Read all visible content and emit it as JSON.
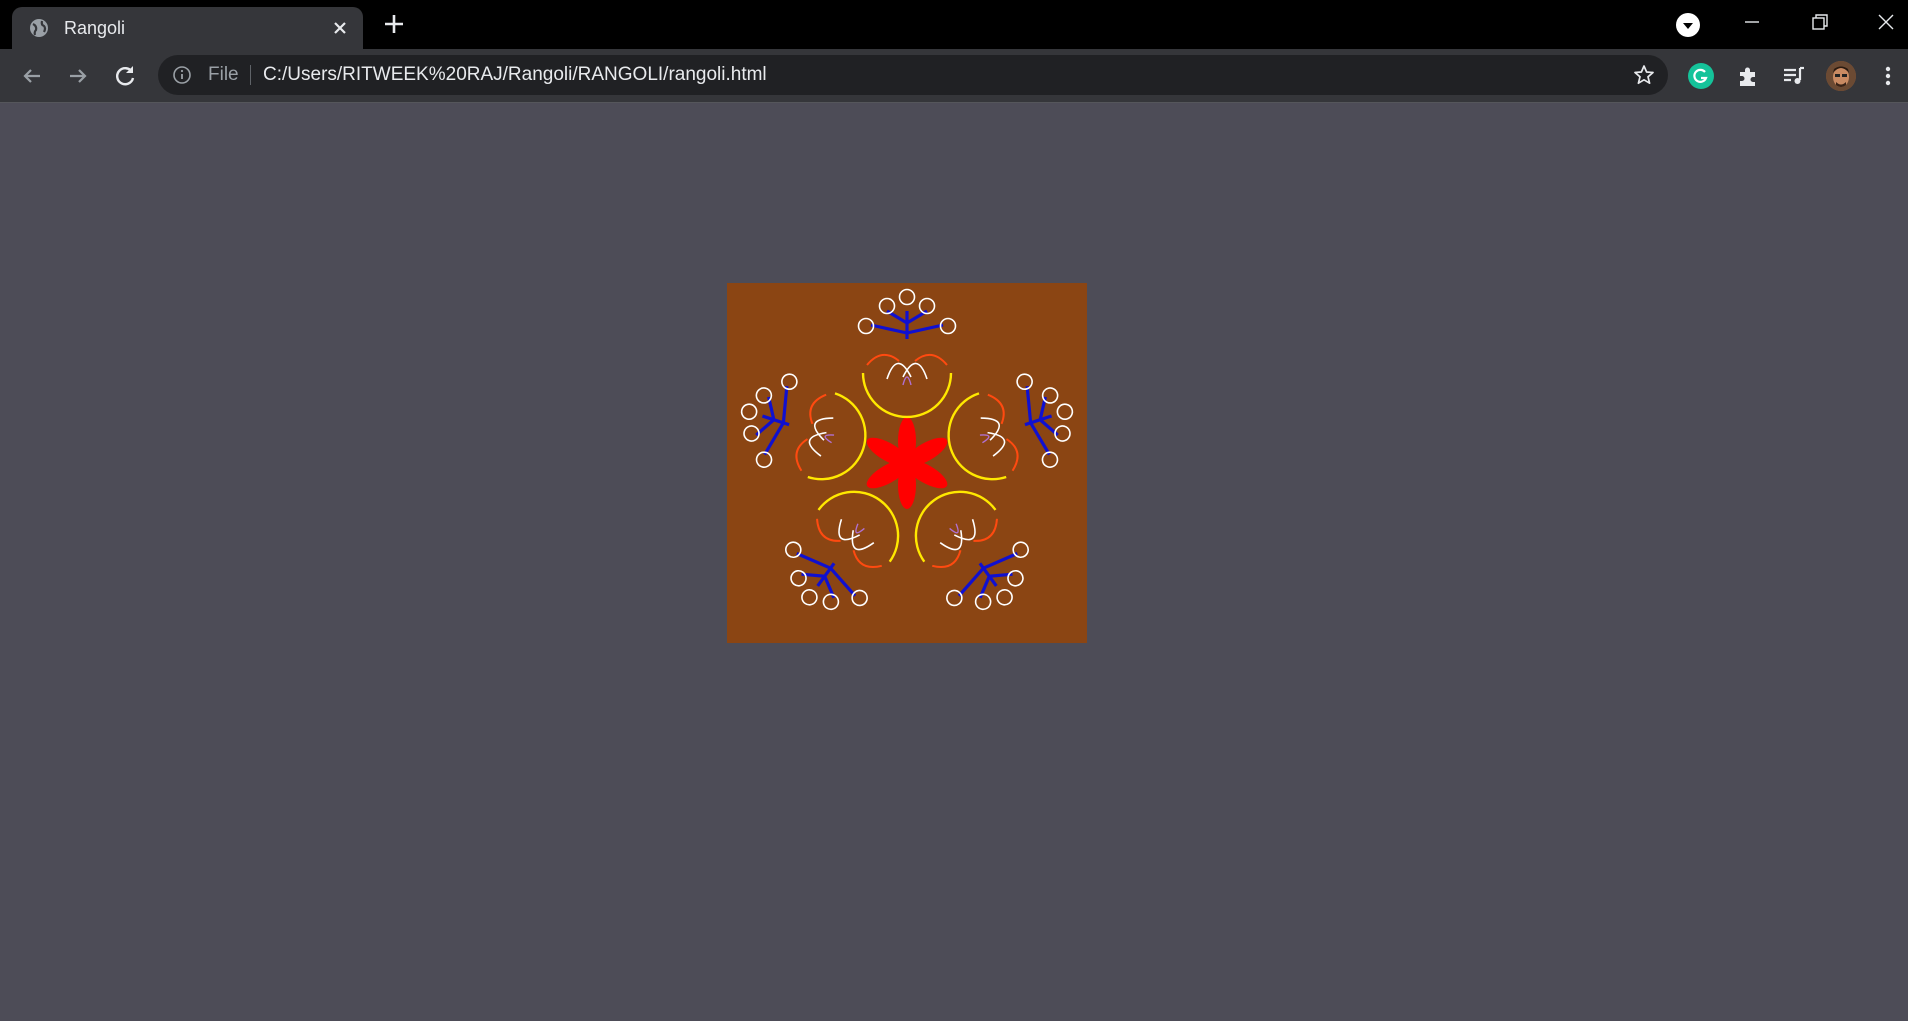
{
  "browser": {
    "tab_title": "Rangoli",
    "address_scheme_label": "File",
    "url": "C:/Users/RITWEEK%20RAJ/Rangoli/RANGOLI/rangoli.html"
  },
  "icons": {
    "tab_favicon": "globe-icon",
    "tab_close": "close-icon",
    "new_tab": "plus-icon",
    "back": "arrow-left-icon",
    "forward": "arrow-right-icon",
    "reload": "reload-icon",
    "site_info": "info-icon",
    "bookmark": "star-icon",
    "extensions": "puzzle-icon",
    "media": "playlist-icon",
    "menu": "kebab-icon"
  },
  "colors": {
    "page_background": "#4d4c57",
    "canvas_background": "#8b4513",
    "center_flower": "#ff0000",
    "branches": "#1010d0",
    "arcs": "#ffe800",
    "dots": "#ffffff"
  }
}
